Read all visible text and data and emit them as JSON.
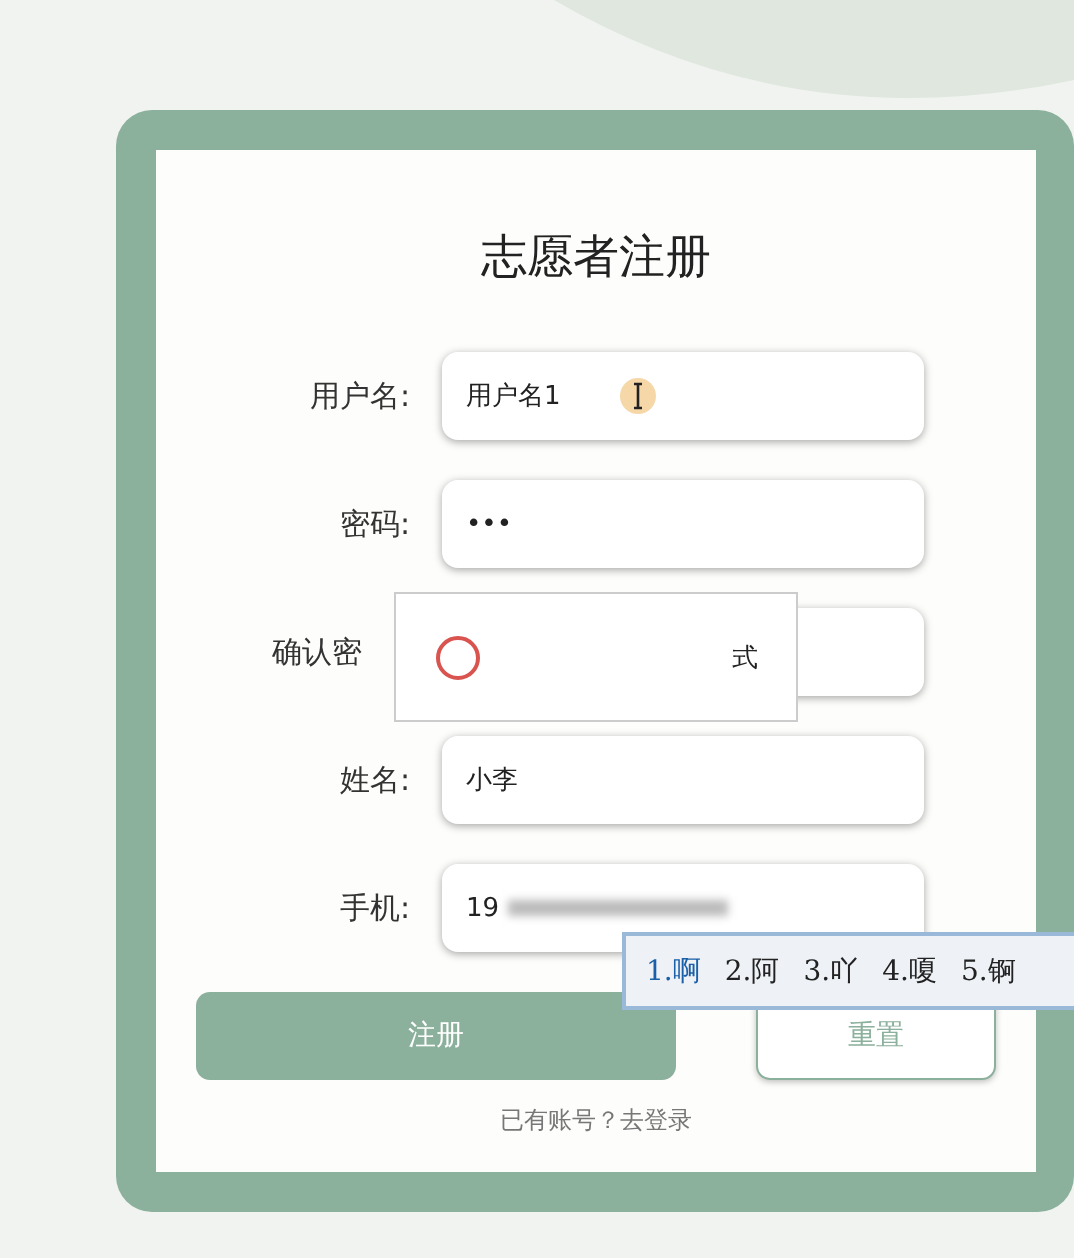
{
  "title": "志愿者注册",
  "fields": [
    {
      "label": "用户名:",
      "value": "用户名1",
      "kind": "text",
      "cursor": true
    },
    {
      "label": "密码:",
      "value": "•••",
      "kind": "password"
    },
    {
      "label": "确认密",
      "kind": "tooltip"
    },
    {
      "label": "姓名:",
      "value": "小李",
      "kind": "text"
    },
    {
      "label": "手机:",
      "value": "19",
      "kind": "smeared"
    }
  ],
  "validation_tooltip": {
    "text": "式"
  },
  "ime_candidates": [
    "1.啊",
    "2.阿",
    "3.吖",
    "4.嗄",
    "5.锕"
  ],
  "buttons": [
    {
      "label": "注册",
      "kind": "primary"
    },
    {
      "label": "重置",
      "kind": "secondary"
    }
  ],
  "login_link": "已有账号？去登录"
}
